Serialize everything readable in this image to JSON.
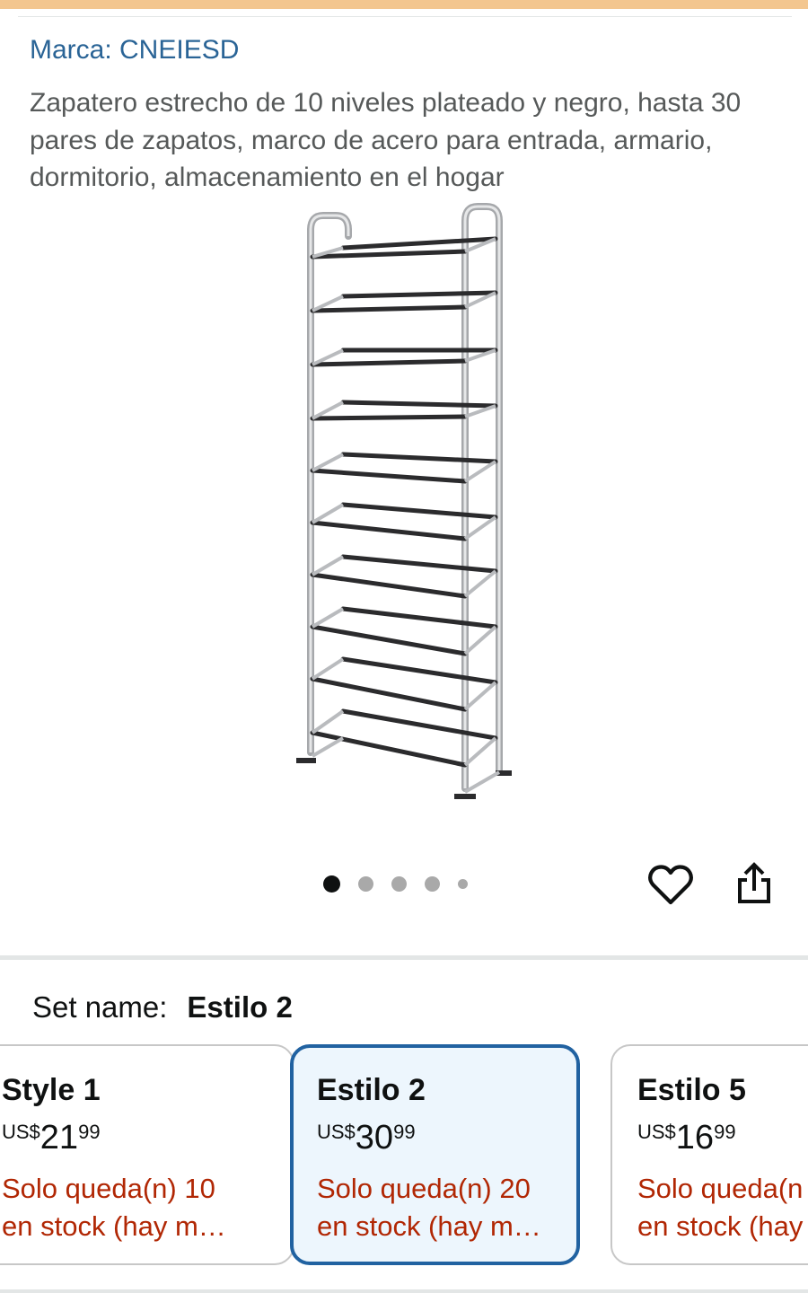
{
  "brand": {
    "label": "Marca: CNEIESD"
  },
  "product": {
    "title": "Zapatero estrecho de 10 niveles plateado y negro, hasta 30 pares de zapatos, marco de acero para entrada, armario, dormitorio, almacenamiento en el hogar",
    "image_icon": "shoe-rack-image"
  },
  "carousel": {
    "total": 5,
    "active_index": 0
  },
  "actions": {
    "wishlist_icon": "heart-icon",
    "share_icon": "share-icon"
  },
  "variation": {
    "label": "Set name:",
    "selected": "Estilo 2",
    "options": [
      {
        "name": "Style 1",
        "currency": "US$",
        "price_whole": "21",
        "price_fraction": "99",
        "stock_line1": "Solo queda(n) 10",
        "stock_line2": "en stock (hay m…"
      },
      {
        "name": "Estilo 2",
        "currency": "US$",
        "price_whole": "30",
        "price_fraction": "99",
        "stock_line1": "Solo queda(n) 20",
        "stock_line2": "en stock (hay m…"
      },
      {
        "name": "Estilo 5",
        "currency": "US$",
        "price_whole": "16",
        "price_fraction": "99",
        "stock_line1": "Solo queda(n",
        "stock_line2": "en stock (hay"
      }
    ]
  },
  "colors": {
    "link": "#2a6496",
    "stock": "#b12704",
    "selected_border": "#2162a1",
    "selected_bg": "#edf6fd",
    "top_strip": "#f3c68f"
  }
}
